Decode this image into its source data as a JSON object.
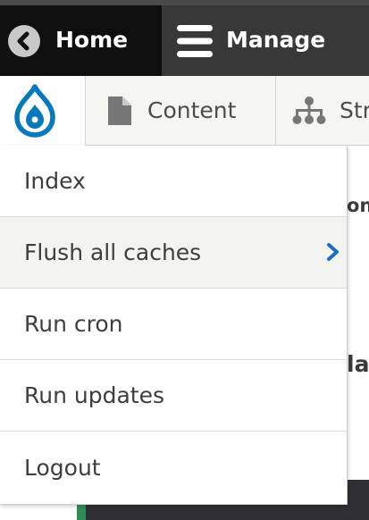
{
  "toolbar": {
    "home_label": "Home",
    "manage_label": "Manage",
    "home_icon": "back-circle-icon",
    "manage_icon": "hamburger-icon"
  },
  "tray": {
    "logo_icon": "drupal-drop-icon",
    "tabs": [
      {
        "label": "Content",
        "icon": "document-icon"
      },
      {
        "label": "Str",
        "icon": "sitemap-icon"
      }
    ]
  },
  "background": {
    "fragment_1": "on",
    "fragment_2": "la"
  },
  "menu": {
    "items": [
      {
        "label": "Index"
      },
      {
        "label": "Flush all caches",
        "icon": "chevron-right-icon"
      },
      {
        "label": "Run cron"
      },
      {
        "label": "Run updates"
      },
      {
        "label": "Logout"
      }
    ]
  },
  "colors": {
    "toolbar_bg": "#0f0f0f",
    "manage_active_bg": "#383838",
    "drupal_blue": "#0678be",
    "tray_bg": "#f5f5f2",
    "menu_hover_bg": "#f3f3f0",
    "chevron_blue": "#1b6fc4"
  }
}
